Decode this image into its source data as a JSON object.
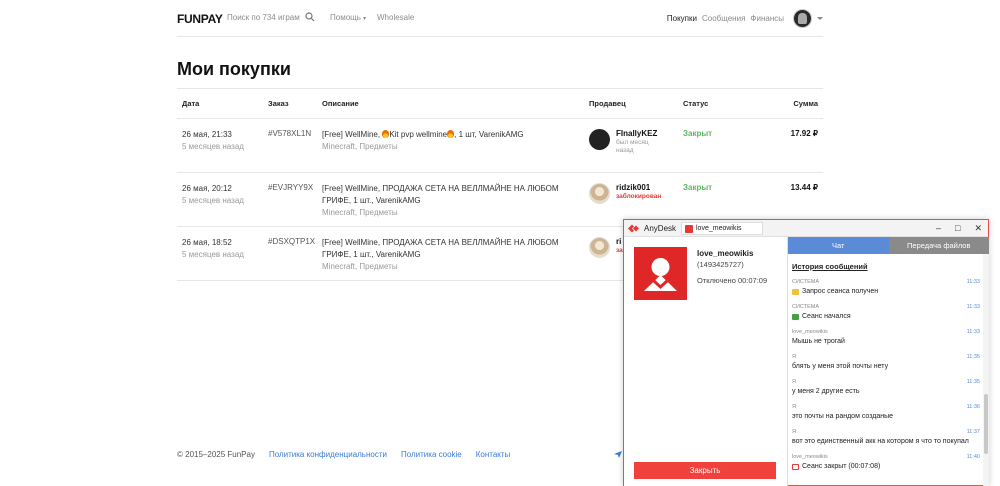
{
  "header": {
    "logo": "FUNPAY",
    "search_placeholder": "Поиск по 734 играм",
    "help": "Помощь",
    "wholesale": "Wholesale",
    "nav": [
      {
        "label": "Покупки",
        "active": true
      },
      {
        "label": "Сообщения",
        "active": false
      },
      {
        "label": "Финансы",
        "active": false
      }
    ]
  },
  "page": {
    "title": "Мои покупки"
  },
  "table": {
    "columns": [
      "Дата",
      "Заказ",
      "Описание",
      "Продавец",
      "Статус",
      "Сумма"
    ],
    "rows": [
      {
        "date": "26 мая, 21:33",
        "ago": "5 месяцев назад",
        "order": "#V578XL1N",
        "desc_pre": "[Free] WellMine, ",
        "desc_mid": "Kit pvp wellmine",
        "desc_post": ", 1 шт, VarenikAMG",
        "category": "Minecraft, Предметы",
        "seller": "FInallyKEZ",
        "seller_sub": "был месяц назад",
        "status": "Закрыт",
        "sum": "17.92 ₽"
      },
      {
        "date": "26 мая, 20:12",
        "ago": "5 месяцев назад",
        "order": "#EVJRYY9X",
        "desc": "[Free] WellMine, ПРОДАЖА СЕТА НА ВЕЛЛМАЙНЕ НА ЛЮБОМ ГРИФЕ, 1 шт., VarenikAMG",
        "category": "Minecraft, Предметы",
        "seller": "ridzik001",
        "seller_sub": "заблокирован",
        "status": "Закрыт",
        "sum": "13.44 ₽"
      },
      {
        "date": "26 мая, 18:52",
        "ago": "5 месяцев назад",
        "order": "#DSXQTP1X",
        "desc": "[Free] WellMine, ПРОДАЖА СЕТА НА ВЕЛЛМАЙНЕ НА ЛЮБОМ ГРИФЕ, 1 шт., VarenikAMG",
        "category": "Minecraft, Предметы",
        "seller": "ri",
        "seller_sub": "за"
      }
    ]
  },
  "footer": {
    "copyright": "© 2015–2025 FunPay",
    "links": [
      "Политика конфиденциальности",
      "Политика cookie",
      "Контакты"
    ]
  },
  "anydesk": {
    "app_name": "AnyDesk",
    "tab_label": "love_meowikis",
    "controls": [
      "–",
      "□",
      "✕"
    ],
    "user": "love_meowikis",
    "user_id": "(1493425727)",
    "state": "Отключено 00:07:09",
    "close_label": "Закрыть",
    "tabs": {
      "chat": "Чат",
      "files": "Передача файлов"
    },
    "history_title": "История сообщений",
    "messages": [
      {
        "from": "СИСТЕМА",
        "time": "11:33",
        "text": "Запрос сеанса получен",
        "icon": "request"
      },
      {
        "from": "СИСТЕМА",
        "time": "11:33",
        "text": "Сеанс начался",
        "icon": "ok"
      },
      {
        "from": "love_meowikis",
        "time": "11:33",
        "text": "Мышь не трогай",
        "icon": ""
      },
      {
        "from": "Я",
        "time": "11:35",
        "text": "блять у меня этой почты нету",
        "icon": ""
      },
      {
        "from": "Я",
        "time": "11:35",
        "text": "у меня 2 другие есть",
        "icon": ""
      },
      {
        "from": "Я",
        "time": "11:36",
        "text": "это почты на рандом созданые",
        "icon": ""
      },
      {
        "from": "Я",
        "time": "11:37",
        "text": "вот это единственный акк на котором я что то покупал",
        "icon": ""
      },
      {
        "from": "love_meowikis",
        "time": "11:40",
        "text": "Сеанс закрыт (00:07:08)",
        "icon": "end"
      }
    ]
  }
}
